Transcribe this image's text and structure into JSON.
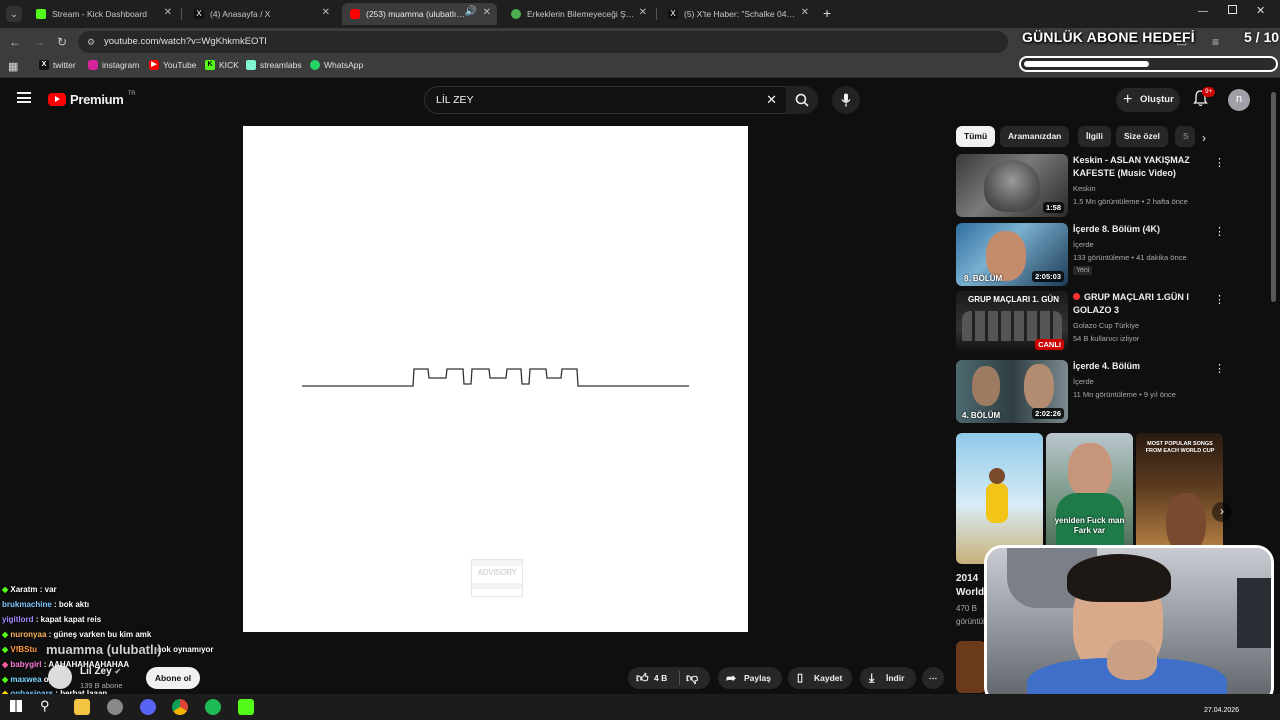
{
  "browser": {
    "tabs": [
      {
        "title": "Stream - Kick Dashboard",
        "favicon": "kick-icon",
        "color": "#53fc18"
      },
      {
        "title": "(4) Anasayfa / X",
        "favicon": "x-icon",
        "color": "#000000"
      },
      {
        "title": "(253) muamma (ulubatlı) - Y",
        "favicon": "youtube-icon",
        "color": "#ff0000",
        "active": true
      },
      {
        "title": "Erkeklerin Bilemeyeceği Şeyler",
        "favicon": "web-icon",
        "color": "#4caf50"
      },
      {
        "title": "(5) X'te Haber: \"Schalke 04'ün",
        "favicon": "x-icon",
        "color": "#000000"
      }
    ],
    "url": "youtube.com/watch?v=WgKhkmkEOTI",
    "bookmarks": [
      "twitter",
      "instagram",
      "YouTube",
      "KICK",
      "streamlabs",
      "WhatsApp"
    ]
  },
  "overlay": {
    "goal_title": "GÜNLÜK ABONE HEDEFİ",
    "goal_count": "5 / 10",
    "goal_progress": 0.5
  },
  "youtube": {
    "logo_text": "Premium",
    "logo_badge": "TR",
    "search_value": "LİL ZEY",
    "create_label": "Oluştur",
    "notif_count": "9+",
    "avatar_letter": "n",
    "chips": [
      "Tümü",
      "Aramanızdan",
      "İlgili",
      "Size özel",
      "S"
    ],
    "recommendations": [
      {
        "title": "Keskin - ASLAN YAKIŞMAZ KAFESTE (Music Video)",
        "channel": "Keskin",
        "meta": "1,5 Mn görüntüleme • 2 hafta önce",
        "duration": "1:58"
      },
      {
        "title": "İçerde 8. Bölüm (4K)",
        "channel": "İçerde",
        "meta": "133 görüntüleme • 41 dakika önce",
        "duration": "2:05:03",
        "badge": "Yeni",
        "thumb_label": "8. BÖLÜM"
      },
      {
        "title": "GRUP MAÇLARI 1.GÜN I GOLAZO 3",
        "channel": "Golazo Cup Türkiye",
        "meta": "54 B kullanıcı izliyor",
        "duration": "CANLI",
        "thumb_label": "GRUP MAÇLARI 1. GÜN"
      },
      {
        "title": "İçerde 4. Bölüm",
        "channel": "İçerde",
        "meta": "11 Mn görüntüleme • 9 yıl önce",
        "duration": "2:02:26",
        "thumb_label": "4. BÖLÜM"
      }
    ],
    "shorts": [
      {
        "caption": ""
      },
      {
        "caption": "yeniden Fuck man Fark var"
      },
      {
        "caption": "MOST POPULAR SONGS FROM EACH WORLD CUP"
      }
    ],
    "partial_title": "2014 World",
    "partial_meta": "470 B",
    "partial_meta2": "görüntüleme",
    "video_title_overlay": "muamma (ulubatlı)",
    "channel_name": "Lil Zey",
    "channel_subs": "139 B abone",
    "subscribe_label": "Abone ol",
    "like_count": "4 B",
    "share_label": "Paylaş",
    "save_label": "Kaydet",
    "download_label": "İndir",
    "advisory_text": "PARENTAL ADVISORY EXPLICIT CONTENT"
  },
  "chat": [
    {
      "user": "Xaratm",
      "msg": "var",
      "color": "#ffffff"
    },
    {
      "user": "brukmachine",
      "msg": "bok aktı",
      "color": "#7ec8ff"
    },
    {
      "user": "yigitlord",
      "msg": "kapat kapat reis",
      "color": "#a58aff"
    },
    {
      "user": "nuronyaa",
      "msg": "güneş varken bu kim amk",
      "color": "#ffb35c"
    },
    {
      "user": "VfBStu",
      "msg": "çok oynamıyor",
      "color": "#ff9a3c"
    },
    {
      "user": "babygirl",
      "msg": "AAHAHAHAAHAHAA",
      "color": "#ff7ad9"
    },
    {
      "user": "maxwea",
      "msg": "oyo",
      "color": "#7cd7ff"
    },
    {
      "user": "onbasipars",
      "msg": "berbat laaan",
      "color": "#7ec8ff"
    }
  ],
  "taskbar": {
    "date": "27.04.2026"
  }
}
